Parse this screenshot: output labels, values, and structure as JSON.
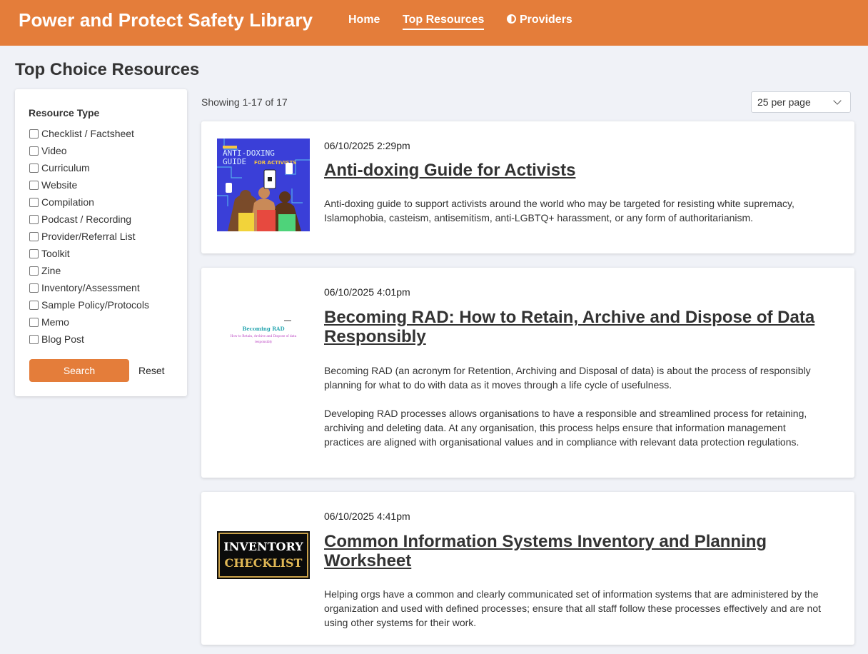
{
  "header": {
    "site_title": "Power and Protect Safety Library",
    "nav": [
      {
        "label": "Home",
        "active": false
      },
      {
        "label": "Top Resources",
        "active": true
      },
      {
        "label": "Providers",
        "active": false,
        "icon": "half-circle-icon"
      }
    ],
    "bar_color": "#e47d3a"
  },
  "page": {
    "title": "Top Choice Resources"
  },
  "filters": {
    "heading": "Resource Type",
    "options": [
      "Checklist / Factsheet",
      "Video",
      "Curriculum",
      "Website",
      "Compilation",
      "Podcast / Recording",
      "Provider/Referral List",
      "Toolkit",
      "Zine",
      "Inventory/Assessment",
      "Sample Policy/Protocols",
      "Memo",
      "Blog Post"
    ],
    "search_label": "Search",
    "reset_label": "Reset"
  },
  "results": {
    "showing": "Showing 1-17 of 17",
    "per_page": "25 per page",
    "items": [
      {
        "date": "06/10/2025 2:29pm",
        "title": "Anti-doxing Guide for Activists",
        "description": [
          "Anti-doxing guide to support activists around the world who may be targeted for resisting white supremacy, Islamophobia, casteism, antisemitism, anti-LGBTQ+ harassment, or any form of authoritarianism."
        ],
        "thumb": {
          "line1": "ANTI-DOXING",
          "line2": "GUIDE",
          "line3": "FOR ACTIVISTS"
        }
      },
      {
        "date": "06/10/2025 4:01pm",
        "title": "Becoming RAD: How to Retain, Archive and Dispose of Data Responsibly",
        "description": [
          "Becoming RAD (an acronym for Retention, Archiving and Disposal of data) is about the process of responsibly planning for what to do with data as it moves through a life cycle of usefulness.",
          "Developing RAD processes allows organisations to have a responsible and streamlined process for retaining, archiving and deleting data. At any organisation, this process helps ensure that information management practices are aligned with organisational values and in compliance with relevant data protection regulations."
        ],
        "thumb": {
          "line1": "Becoming RAD",
          "line2": "How to Retain, Archive and Dispose of data",
          "line3": "responsibly"
        }
      },
      {
        "date": "06/10/2025 4:41pm",
        "title": "Common Information Systems Inventory and Planning Worksheet",
        "description": [
          "Helping orgs have a common and clearly communicated set of information systems that are administered by the organization and used with defined processes; ensure that all staff follow these processes effectively and are not using other systems for their work."
        ],
        "thumb": {
          "line1": "INVENTORY",
          "line2": "CHECKLIST"
        }
      }
    ]
  }
}
